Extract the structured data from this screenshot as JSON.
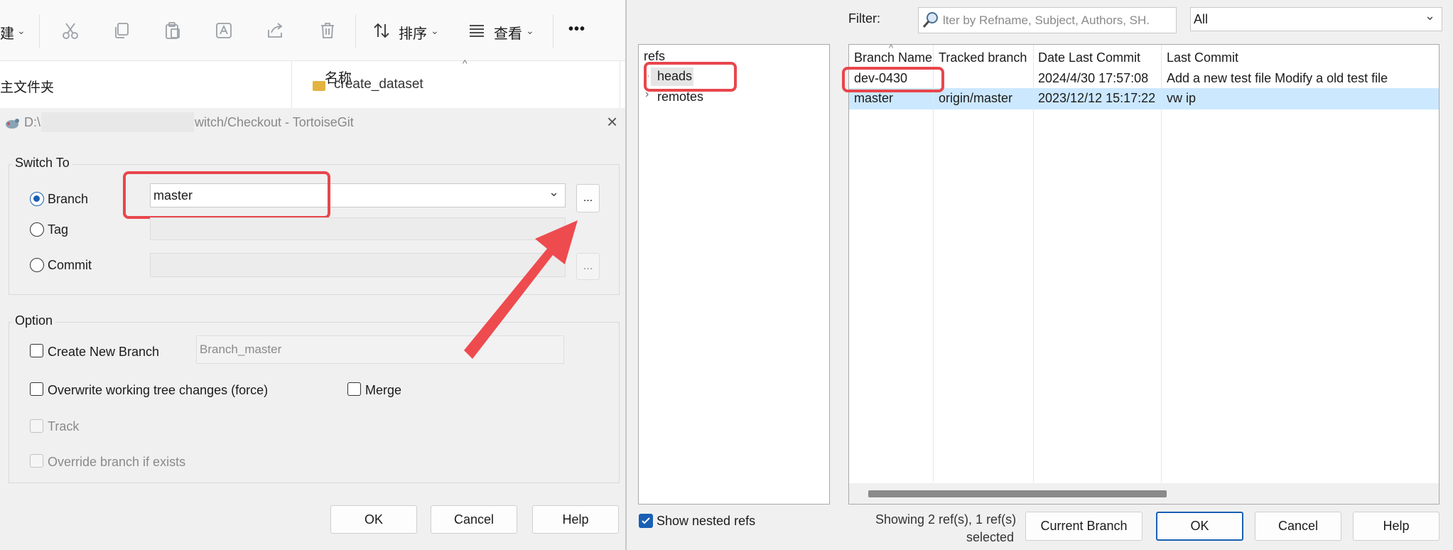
{
  "explorer": {
    "toolbar": {
      "new_label": "建",
      "sort_label": "排序",
      "view_label": "查看",
      "more_label": "•••"
    },
    "folder_label": "主文件夹",
    "name_header": "名称",
    "file_name": "create_dataset"
  },
  "switch_dialog": {
    "title_prefix": "D:\\",
    "title_suffix": "witch/Checkout - TortoiseGit",
    "switch_to_group": "Switch To",
    "branch_label": "Branch",
    "branch_value": "master",
    "tag_label": "Tag",
    "commit_label": "Commit",
    "browse_label": "...",
    "option_group": "Option",
    "create_new_branch_label": "Create New Branch",
    "new_branch_name": "Branch_master",
    "overwrite_label": "Overwrite working tree changes (force)",
    "merge_label": "Merge",
    "track_label": "Track",
    "override_label": "Override branch if exists",
    "ok_label": "OK",
    "cancel_label": "Cancel",
    "help_label": "Help"
  },
  "refs_dialog": {
    "filter_label": "Filter:",
    "filter_placeholder": "lter by Refname, Subject, Authors, SH.",
    "filter_scope": "All",
    "tree": {
      "root": "refs",
      "heads": "heads",
      "remotes": "remotes"
    },
    "columns": [
      "Branch Name",
      "Tracked branch",
      "Date Last Commit",
      "Last Commit"
    ],
    "rows": [
      {
        "branch": "dev-0430",
        "tracked": "",
        "date": "2024/4/30 17:57:08",
        "commit": "Add a new test file Modify a old test file"
      },
      {
        "branch": "master",
        "tracked": "origin/master",
        "date": "2023/12/12 15:17:22",
        "commit": "vw ip"
      }
    ],
    "show_nested_label": "Show nested refs",
    "status_line1": "Showing 2 ref(s), 1 ref(s)",
    "status_line2": "selected",
    "current_branch_label": "Current Branch",
    "ok_label": "OK",
    "cancel_label": "Cancel",
    "help_label": "Help"
  },
  "colors": {
    "accent": "#1a5fb4",
    "highlight": "#e8464c",
    "selected_row": "#cce8ff"
  }
}
